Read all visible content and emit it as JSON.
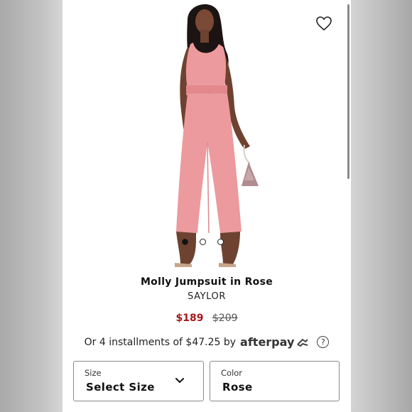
{
  "product": {
    "title": "Molly Jumpsuit in Rose",
    "brand": "SAYLOR",
    "price_sale": "$189",
    "price_original": "$209",
    "image_count": 3,
    "active_image_index": 0
  },
  "afterpay": {
    "text": "Or 4 installments of $47.25 by",
    "logo_text": "afterpay",
    "help_icon": "?"
  },
  "size_select": {
    "label": "Size",
    "value": "Select Size"
  },
  "color_select": {
    "label": "Color",
    "value": "Rose"
  },
  "icons": {
    "favorite": "heart-icon",
    "dropdown": "chevron-down-icon",
    "help": "question-circle-icon",
    "afterpay_arrows": "afterpay-arrows-icon"
  },
  "colors": {
    "sale_price": "#a3191b",
    "jumpsuit": "#ec9a9d"
  }
}
